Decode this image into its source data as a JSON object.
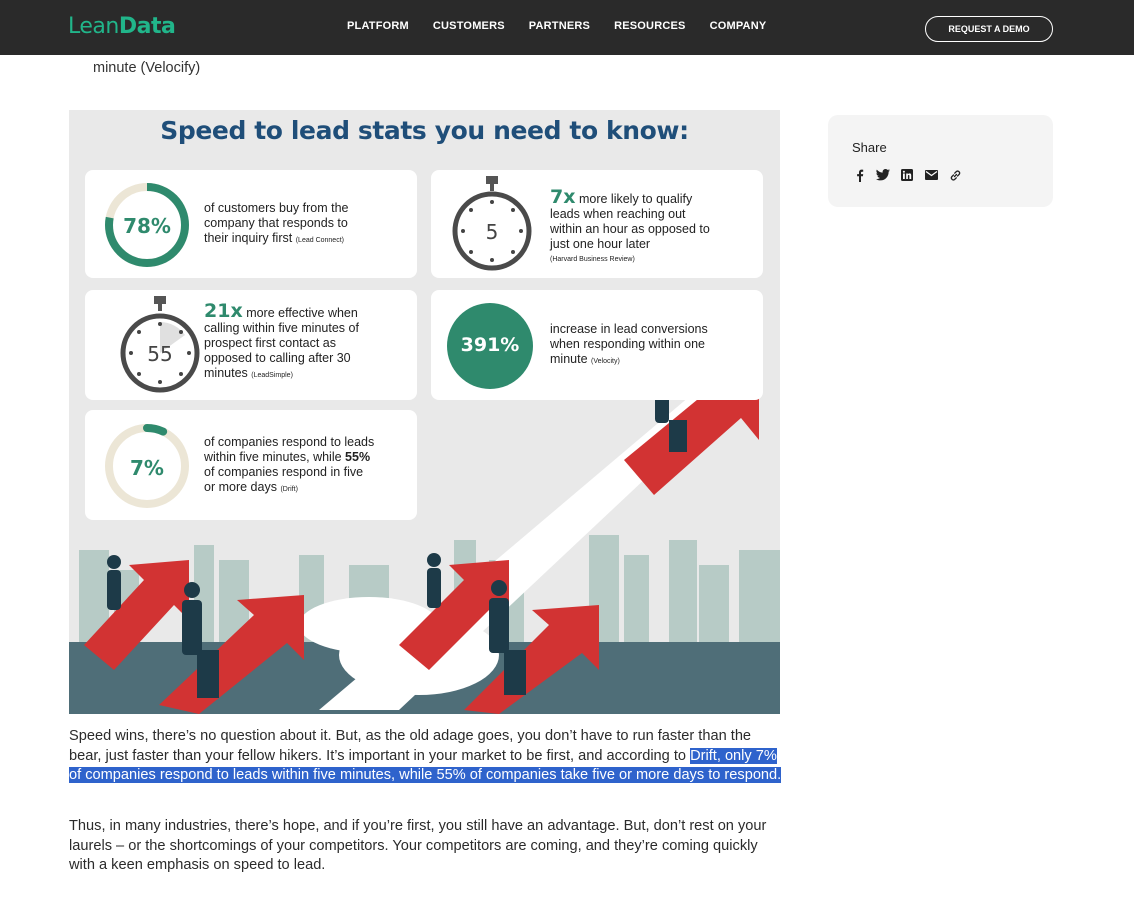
{
  "header": {
    "logo": {
      "part1": "Lean",
      "part2": "Data"
    },
    "nav": [
      "PLATFORM",
      "CUSTOMERS",
      "PARTNERS",
      "RESOURCES",
      "COMPANY"
    ],
    "cta": "REQUEST A DEMO"
  },
  "article": {
    "prev_line": "minute (Velocify)",
    "infographic": {
      "title": "Speed to lead stats you need to know:",
      "stats": [
        {
          "value": "78%",
          "text_lines": [
            "of customers buy from the",
            "company that responds to",
            "their inquiry first"
          ],
          "source": "(Lead Connect)"
        },
        {
          "value": "7x",
          "text_first": "more likely to qualify",
          "text_lines": [
            "leads when reaching out",
            "within an hour as opposed to",
            "just one hour later"
          ],
          "source": "(Harvard Business Review)",
          "timer": "5"
        },
        {
          "value": "21x",
          "text_first": "more effective when",
          "text_lines": [
            "calling within five minutes of",
            "prospect first contact as",
            "opposed to calling after 30"
          ],
          "last_line": "minutes",
          "source": "(LeadSimple)",
          "timer": "55"
        },
        {
          "value": "391%",
          "text_lines": [
            "increase in lead conversions",
            "when responding within one"
          ],
          "last_line": "minute",
          "source": "(Velocity)"
        },
        {
          "value": "7%",
          "text_lines": [
            "of companies respond to leads"
          ],
          "line2_pre": "within five minutes, while",
          "line2_bold": "55%",
          "text_lines2": [
            "of companies respond in five"
          ],
          "last_line": "or more days",
          "source": "(Drift)"
        }
      ]
    },
    "para1_pre": "Speed wins, there’s no question about it. But, as the old adage goes, you don’t have to run faster than the bear, just faster than your fellow hikers. It’s important in your market to be first, and according to",
    "para1_hl": "Drift, only 7% of companies respond to leads within five minutes, while 55% of companies take five or more days to respond.",
    "para2": "Thus, in many industries, there’s hope, and if you’re first, you still have an advantage. But, don’t rest on your laurels – or the shortcomings of your competitors. Your competitors are coming, and they’re coming quickly with a keen emphasis on speed to lead."
  },
  "share": {
    "title": "Share",
    "icons": [
      "facebook-icon",
      "twitter-icon",
      "linkedin-icon",
      "email-icon",
      "link-icon"
    ]
  },
  "colors": {
    "brand": "#21b58a",
    "stat_green": "#2f8a6d",
    "title_blue": "#1f4e79",
    "highlight": "#2f63cc",
    "arrow_red": "#d23333"
  }
}
